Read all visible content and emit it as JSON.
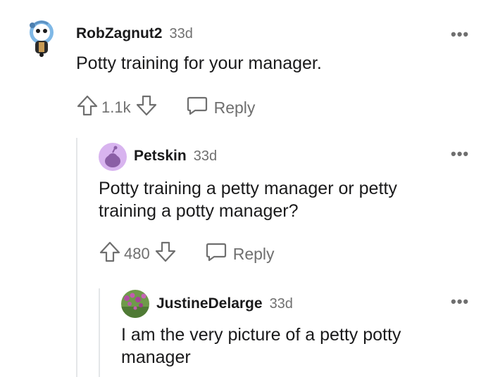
{
  "comments": [
    {
      "username": "RobZagnut2",
      "age": "33d",
      "text": "Potty training for your manager.",
      "votes": "1.1k",
      "reply_label": "Reply",
      "more_label": "•••",
      "avatar": "snoo-avatar"
    },
    {
      "username": "Petskin",
      "age": "33d",
      "text": "Potty training a petty manager or petty training a potty manager?",
      "votes": "480",
      "reply_label": "Reply",
      "more_label": "•••",
      "avatar": "default-purple-avatar"
    },
    {
      "username": "JustineDelarge",
      "age": "33d",
      "text": "I am the very picture of a petty potty manager",
      "more_label": "•••",
      "avatar": "flower-photo-avatar"
    }
  ],
  "colors": {
    "text": "#1a1a1b",
    "meta": "#6f6f6f",
    "thread_line": "#e4e6e8",
    "avatar_purple": "#d8b4ef"
  }
}
